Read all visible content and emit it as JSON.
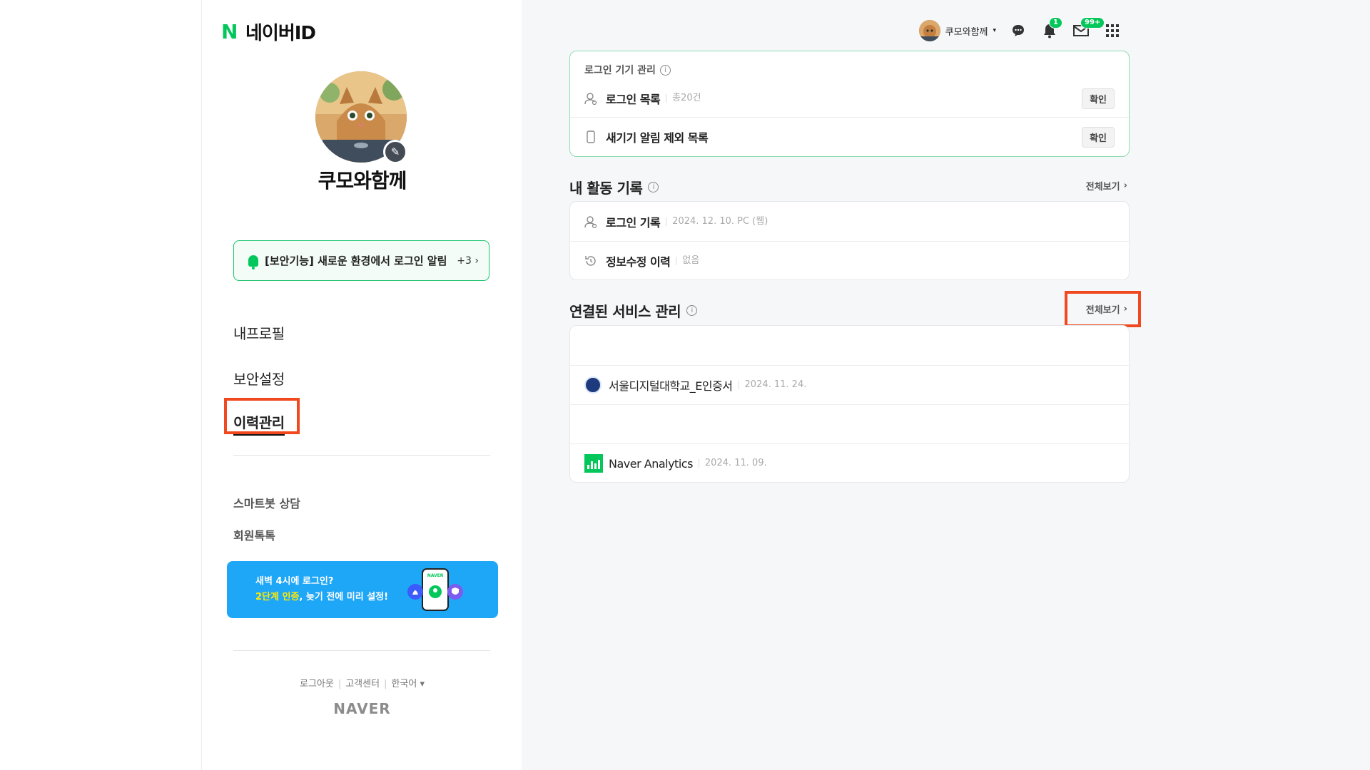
{
  "brand": {
    "n": "N",
    "text": "네이버ID"
  },
  "profile": {
    "name": "쿠모와함께"
  },
  "alert": {
    "text": "[보안기능] 새로운 환경에서 로그인 알림",
    "count": "+3"
  },
  "nav": {
    "items": [
      "내프로필",
      "보안설정",
      "이력관리"
    ],
    "active": "이력관리"
  },
  "sub_nav": [
    "스마트봇 상담",
    "회원톡톡"
  ],
  "banner": {
    "line1": "새벽 4시에 로그인?",
    "line2_highlight": "2단계 인증",
    "line2_rest": ", 늦기 전에 미리 설정!",
    "phone_label": "NAVER"
  },
  "footer": {
    "links": [
      "로그아웃",
      "고객센터",
      "한국어"
    ],
    "logo": "NAVER"
  },
  "topbar": {
    "user": "쿠모와함께",
    "notification_count": "1",
    "mail_count": "99+"
  },
  "login_devices": {
    "title": "로그인 기기 관리",
    "rows": [
      {
        "label": "로그인 목록",
        "meta": "총20건",
        "button": "확인"
      },
      {
        "label": "새기기 알림 제외 목록",
        "meta": "",
        "button": "확인"
      }
    ]
  },
  "activity": {
    "title": "내 활동 기록",
    "see_all": "전체보기",
    "rows": [
      {
        "label": "로그인 기록",
        "meta": "2024. 12. 10. PC (웹)"
      },
      {
        "label": "정보수정 이력",
        "meta": "없음"
      }
    ]
  },
  "services": {
    "title": "연결된 서비스 관리",
    "see_all": "전체보기",
    "rows": [
      {
        "label": "",
        "meta": ""
      },
      {
        "label": "서울디지털대학교_E인증서",
        "meta": "2024. 11. 24."
      },
      {
        "label": "",
        "meta": ""
      },
      {
        "label": "Naver Analytics",
        "meta": "2024. 11. 09."
      }
    ]
  },
  "colors": {
    "accent": "#03c75a",
    "highlight": "#f0491f",
    "banner": "#1ea6f7",
    "page_bg": "#f6f7f9"
  },
  "icons": [
    "pencil-icon",
    "chat-icon",
    "bell-icon",
    "mail-icon",
    "grid-icon",
    "info-icon",
    "person-icon",
    "phone-icon",
    "history-icon",
    "chevron-right-icon"
  ]
}
